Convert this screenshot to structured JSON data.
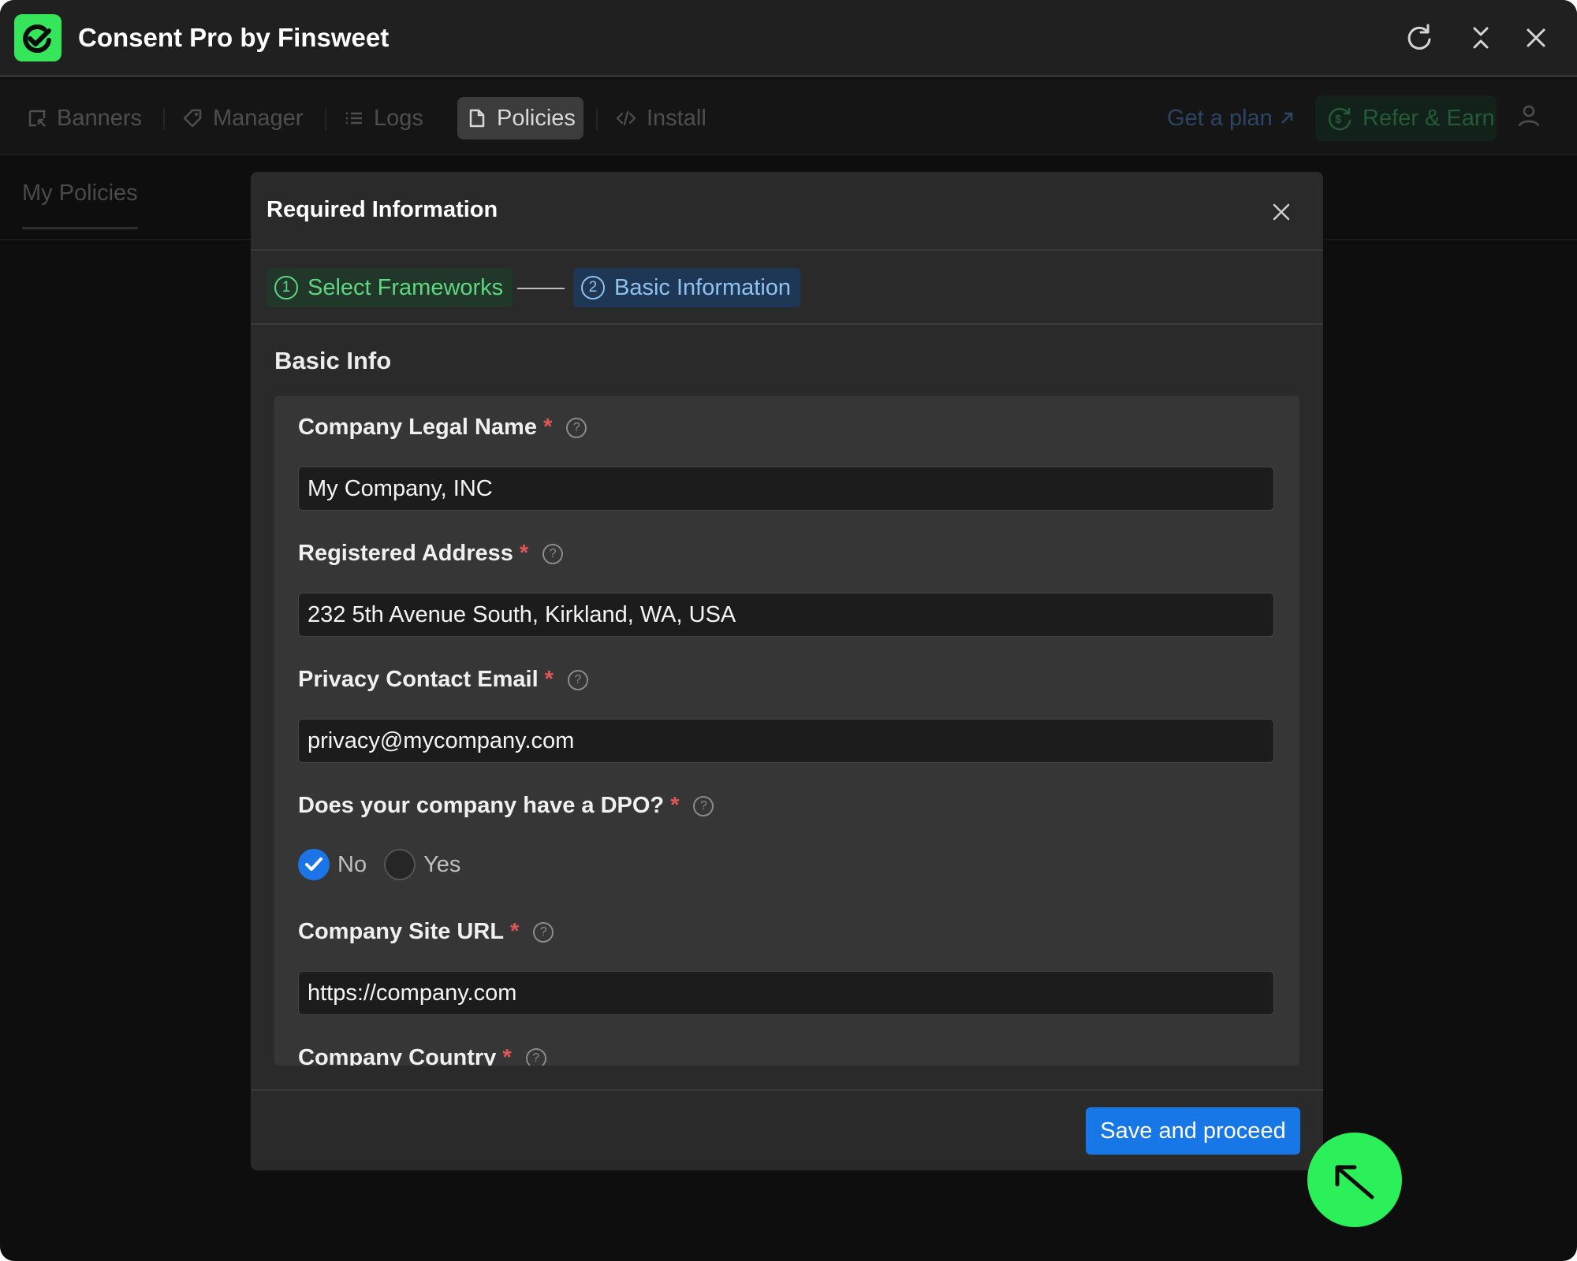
{
  "app": {
    "title": "Consent Pro by Finsweet",
    "logo_icon": "consent-check-icon",
    "brand_color": "#36e65a"
  },
  "titlebar_controls": [
    "refresh-icon",
    "collapse-icon",
    "close-icon"
  ],
  "tabs": [
    {
      "label": "Banners",
      "icon": "banner-icon",
      "active": false
    },
    {
      "label": "Manager",
      "icon": "tag-icon",
      "active": false
    },
    {
      "label": "Logs",
      "icon": "list-icon",
      "active": false
    },
    {
      "label": "Policies",
      "icon": "document-icon",
      "active": true
    },
    {
      "label": "Install",
      "icon": "code-icon",
      "active": false
    }
  ],
  "nav_right": {
    "get_plan": "Get a plan",
    "refer": "Refer & Earn"
  },
  "subnav": {
    "tab": "My Policies"
  },
  "modal": {
    "title": "Required Information",
    "steps": [
      {
        "number": "1",
        "label": "Select Frameworks",
        "state": "done"
      },
      {
        "number": "2",
        "label": "Basic Information",
        "state": "current"
      }
    ],
    "section_title": "Basic Info",
    "fields": [
      {
        "label": "Company Legal Name",
        "required": "*",
        "value": "My Company, INC"
      },
      {
        "label": "Registered Address",
        "required": "*",
        "value": "232 5th Avenue South, Kirkland, WA, USA"
      },
      {
        "label": "Privacy Contact Email",
        "required": "*",
        "value": "privacy@mycompany.com"
      },
      {
        "label": "Does your company have a DPO?",
        "required": "*"
      },
      {
        "label": "Company Site URL",
        "required": "*",
        "value": "https://company.com"
      },
      {
        "label": "Company Country",
        "required": "*"
      }
    ],
    "dpo_options": [
      {
        "label": "No",
        "checked": true
      },
      {
        "label": "Yes",
        "checked": false
      }
    ],
    "help_glyph": "?",
    "save_button": "Save and proceed"
  },
  "colors": {
    "accent_blue": "#1877e6",
    "step_done": "#5fd67f",
    "step_current": "#8fc2ef",
    "required": "#e05555"
  }
}
